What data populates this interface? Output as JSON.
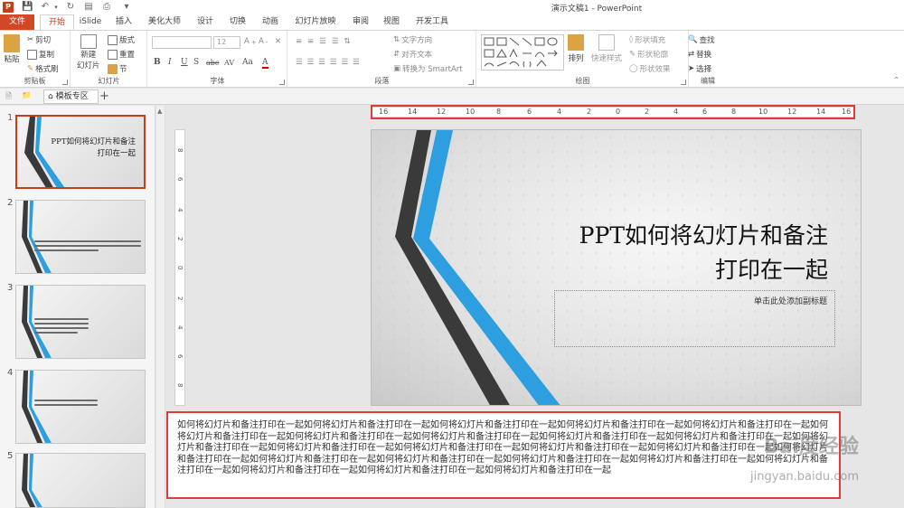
{
  "window": {
    "title": "演示文稿1 - PowerPoint"
  },
  "qat": {
    "logo": "P"
  },
  "tabs": [
    {
      "label": "文件"
    },
    {
      "label": "开始"
    },
    {
      "label": "iSlide"
    },
    {
      "label": "插入"
    },
    {
      "label": "美化大师"
    },
    {
      "label": "设计"
    },
    {
      "label": "切换"
    },
    {
      "label": "动画"
    },
    {
      "label": "幻灯片放映"
    },
    {
      "label": "审阅"
    },
    {
      "label": "视图"
    },
    {
      "label": "开发工具"
    }
  ],
  "ribbon": {
    "clipboard": {
      "paste": "粘贴",
      "cut": "剪切",
      "copy": "复制",
      "format_painter": "格式刷",
      "label": "剪贴板"
    },
    "slides": {
      "new_slide_line1": "新建",
      "new_slide_line2": "幻灯片",
      "layout": "版式",
      "reset": "重置",
      "section": "节",
      "label": "幻灯片"
    },
    "font": {
      "font_size": "12",
      "label": "字体",
      "bold": "B",
      "italic": "I",
      "underline": "U",
      "strike": "S",
      "abc": "abc",
      "spacing": "AV",
      "case": "Aa",
      "color": "A"
    },
    "paragraph": {
      "text_direction": "文字方向",
      "align_text": "对齐文本",
      "smartart": "转换为 SmartArt",
      "label": "段落"
    },
    "drawing": {
      "arrange": "排列",
      "quick_styles": "快速样式",
      "shape_fill": "形状填充",
      "shape_outline": "形状轮廓",
      "shape_effects": "形状效果",
      "label": "绘图"
    },
    "editing": {
      "find": "查找",
      "replace": "替换",
      "select": "选择",
      "label": "编辑"
    }
  },
  "strip": {
    "tab_label": "模板专区"
  },
  "slides": [
    {
      "num": "1",
      "title": "PPT如何将幻灯片和备注打印在一起"
    },
    {
      "num": "2"
    },
    {
      "num": "3"
    },
    {
      "num": "4"
    },
    {
      "num": "5"
    }
  ],
  "ruler": {
    "h": [
      "16",
      "14",
      "12",
      "10",
      "8",
      "6",
      "4",
      "2",
      "0",
      "2",
      "4",
      "6",
      "8",
      "10",
      "12",
      "14",
      "16"
    ],
    "v": [
      "8",
      "6",
      "4",
      "2",
      "0",
      "2",
      "4",
      "6",
      "8"
    ]
  },
  "slide": {
    "title_line1": "PPT如何将幻灯片和备注",
    "title_line2": "打印在一起",
    "subtitle_placeholder": "单击此处添加副标题"
  },
  "notes": {
    "text": "如何将幻灯片和备注打印在一起如何将幻灯片和备注打印在一起如何将幻灯片和备注打印在一起如何将幻灯片和备注打印在一起如何将幻灯片和备注打印在一起如何将幻灯片和备注打印在一起如何将幻灯片和备注打印在一起如何将幻灯片和备注打印在一起如何将幻灯片和备注打印在一起如何将幻灯片和备注打印在一起如何将幻灯片和备注打印在一起如何将幻灯片和备注打印在一起如何将幻灯片和备注打印在一起如何将幻灯片和备注打印在一起如何将幻灯片和备注打印在一起如何将幻灯片和备注打印在一起如何将幻灯片和备注打印在一起如何将幻灯片和备注打印在一起如何将幻灯片和备注打印在一起如何将幻灯片和备注打印在一起如何将幻灯片和备注打印在一起如何将幻灯片和备注打印在一起如何将幻灯片和备注打印在一起如何将幻灯片和备注打印在一起"
  },
  "watermark": {
    "main": "Bai度经验",
    "sub": "jingyan.baidu.com"
  },
  "colors": {
    "accent": "#c43e1c",
    "file_tab": "#d24726",
    "highlight": "#e03b3b",
    "blue": "#2d9ee0",
    "dark": "#3a3a3a"
  }
}
